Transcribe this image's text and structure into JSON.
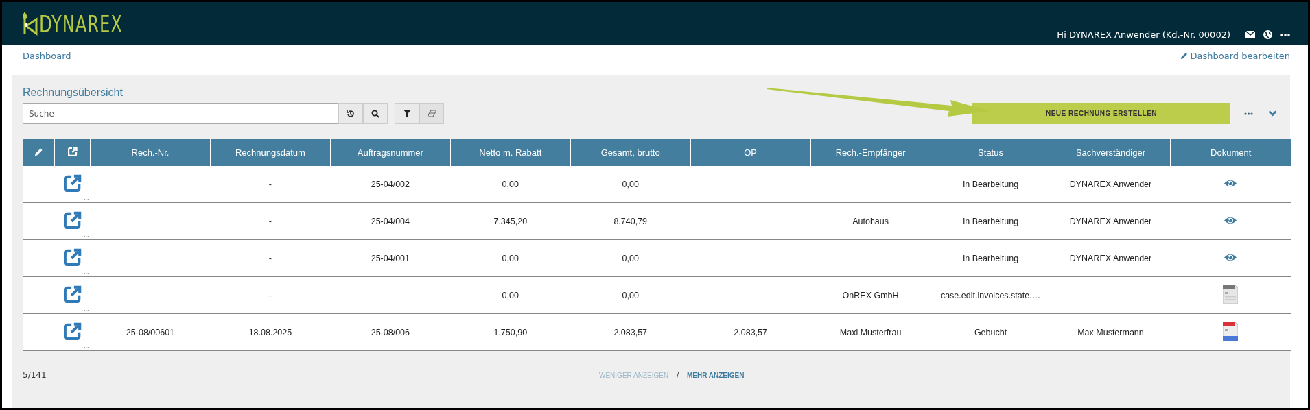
{
  "header": {
    "logo": "DYNAREX",
    "greeting": "Hi DYNAREX Anwender (Kd.-Nr. 00002)"
  },
  "breadcrumb": {
    "link": "Dashboard",
    "edit_link": "Dashboard bearbeiten"
  },
  "panel": {
    "title": "Rechnungsübersicht",
    "search": {
      "placeholder": "Suche"
    },
    "create_button": "NEUE RECHNUNG ERSTELLEN"
  },
  "table": {
    "columns": [
      "Rech.-Nr.",
      "Rechnungsdatum",
      "Auftragsnummer",
      "Netto m. Rabatt",
      "Gesamt, brutto",
      "OP",
      "Rech.-Empfänger",
      "Status",
      "Sachverständiger",
      "Dokument"
    ],
    "rows": [
      {
        "row_menu": "...",
        "cells": [
          "",
          "-",
          "25-04/002",
          "0,00",
          "0,00",
          "",
          "",
          "In Bearbeitung",
          "DYNAREX Anwender"
        ],
        "kind": "view"
      },
      {
        "row_menu": "...",
        "cells": [
          "",
          "-",
          "25-04/004",
          "7.345,20",
          "8.740,79",
          "",
          "Autohaus",
          "In Bearbeitung",
          "DYNAREX Anwender"
        ],
        "kind": "view"
      },
      {
        "row_menu": "...",
        "cells": [
          "",
          "-",
          "25-04/001",
          "0,00",
          "0,00",
          "",
          "",
          "In Bearbeitung",
          "DYNAREX Anwender"
        ],
        "kind": "view"
      },
      {
        "row_menu": "...",
        "cells": [
          "",
          "-",
          "",
          "0,00",
          "0,00",
          "",
          "OnREX GmbH",
          "case.edit.invoices.state.…",
          ""
        ],
        "kind": "pdf"
      },
      {
        "row_menu": "...",
        "cells": [
          "25-08/00601",
          "18.08.2025",
          "25-08/006",
          "1.750,90",
          "2.083,57",
          "2.083,57",
          "Maxi Musterfrau",
          "Gebucht",
          "Max Mustermann"
        ],
        "kind": "pdf_booked"
      }
    ]
  },
  "footer": {
    "count": "5/141",
    "links": [
      {
        "label": "WENIGER ANZEIGEN",
        "disabled": true
      },
      {
        "label": "MEHR ANZEIGEN",
        "disabled": false
      }
    ],
    "separator": "/"
  }
}
